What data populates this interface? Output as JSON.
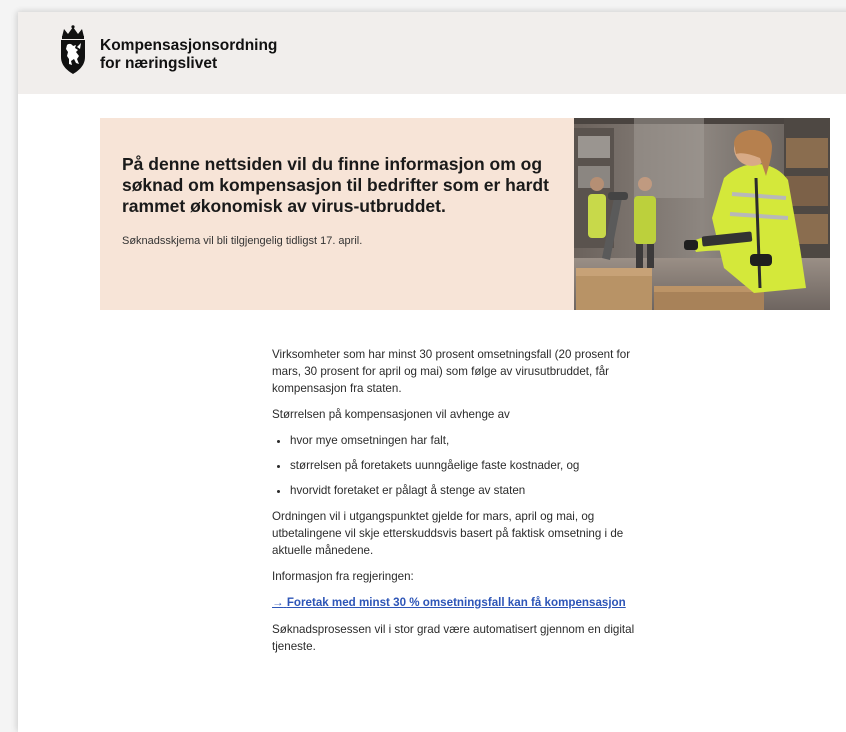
{
  "header": {
    "title_line1": "Kompensasjonsordning",
    "title_line2": "for næringslivet"
  },
  "hero": {
    "title": "På denne nettsiden vil du finne informasjon om og søknad om kompensasjon til bedrifter som er hardt rammet økonomisk av virus-utbruddet.",
    "note": "Søknadsskjema vil bli tilgjengelig tidligst 17. april.",
    "image_name": "warehouse-worker-photo"
  },
  "main": {
    "intro": "Virksomheter som har minst 30 prosent omsetningsfall (20 prosent for mars, 30 prosent for april og mai) som følge av virusutbruddet, får kompensasjon fra staten.",
    "size_intro": "Størrelsen på kompensasjonen vil avhenge av",
    "bullets": [
      "hvor mye omsetningen har falt,",
      "størrelsen på foretakets uunngåelige faste kostnader, og",
      "hvorvidt foretaket er pålagt å stenge av staten"
    ],
    "scheme": "Ordningen vil i utgangspunktet gjelde for mars, april og mai, og utbetalingene vil skje etterskuddsvis basert på faktisk omsetning i de aktuelle månedene.",
    "gov_info_label": "Informasjon fra regjeringen:",
    "link_arrow": "→",
    "link_text": "Foretak med minst 30 % omsetningsfall kan få kompensasjon",
    "closing": "Søknadsprosessen vil i stor grad være automatisert gjennom en digital tjeneste."
  },
  "colors": {
    "header_bg": "#f1eeec",
    "hero_bg": "#f7e4d7",
    "link": "#2d55b7",
    "hi_vis_yellow": "#d4e83a"
  }
}
